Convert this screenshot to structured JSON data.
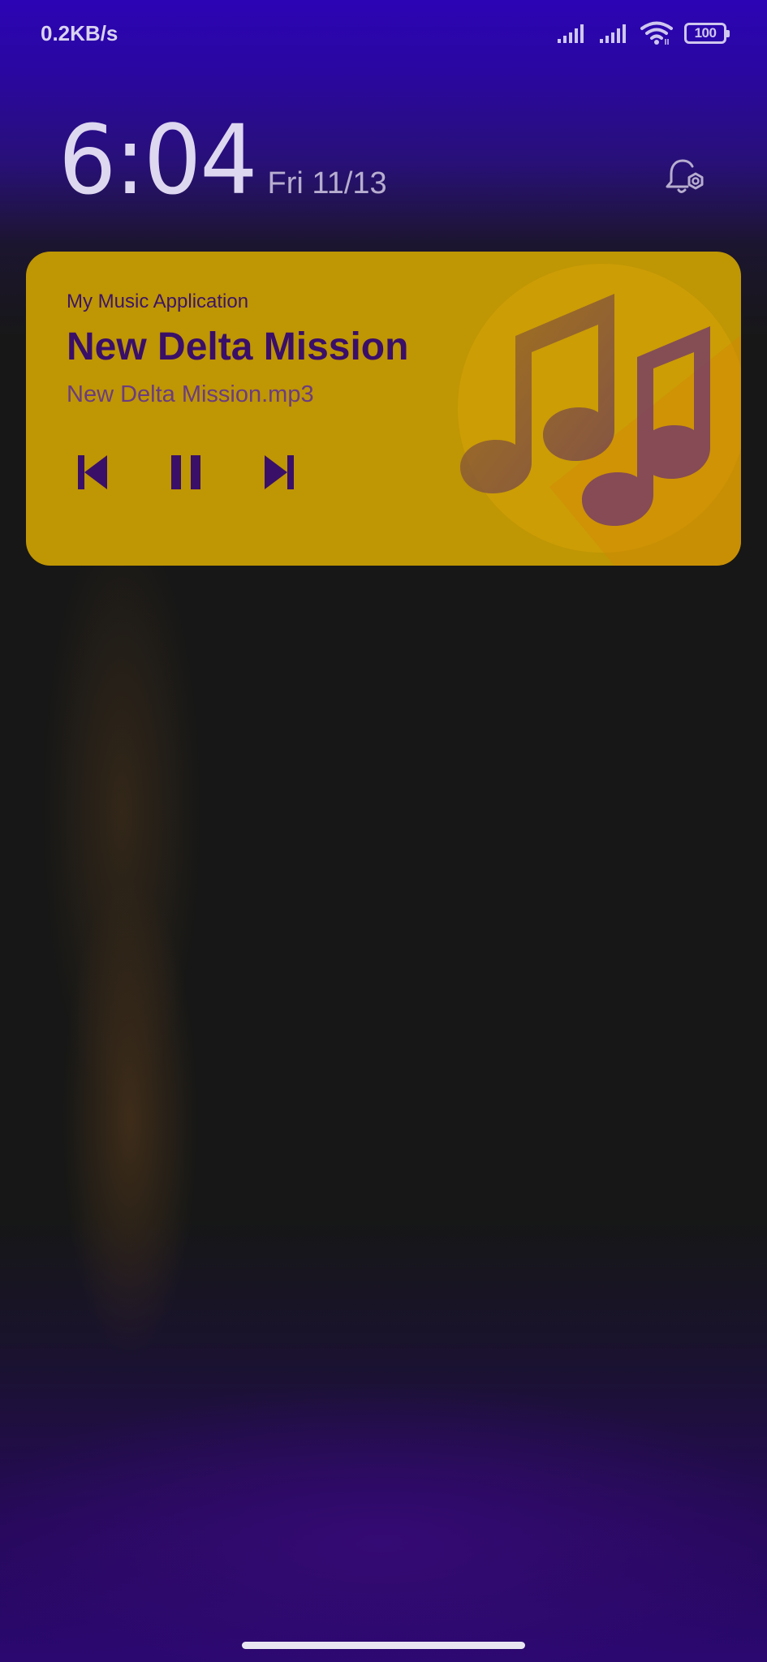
{
  "status_bar": {
    "network_speed": "0.2KB/s",
    "icons": [
      "signal-icon",
      "signal-icon",
      "wifi-icon"
    ],
    "battery_level": "100"
  },
  "lockscreen": {
    "time": "6:04",
    "date": "Fri 11/13",
    "notification_settings_icon": "bell-settings-icon"
  },
  "media_notification": {
    "app_name": "My Music Application",
    "track_title": "New Delta Mission",
    "file_name": "New Delta Mission.mp3",
    "controls": {
      "previous_icon": "skip-previous-icon",
      "pause_icon": "pause-icon",
      "next_icon": "skip-next-icon"
    },
    "album_art_icon": "music-notes-icon",
    "colors": {
      "card_background": "#bf9604",
      "text_primary": "#3a0f68",
      "control_color": "#3a0f68"
    }
  },
  "colors": {
    "status_bar_gradient_top": "#2c04b4",
    "background": "#161716"
  }
}
